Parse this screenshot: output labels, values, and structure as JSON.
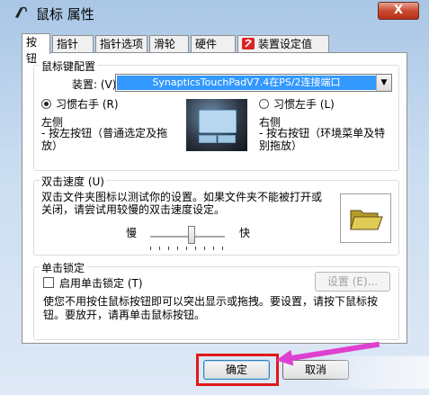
{
  "window": {
    "title": "鼠标 属性",
    "close_label": "X"
  },
  "tabs": [
    {
      "label": "按钮",
      "active": true
    },
    {
      "label": "指针"
    },
    {
      "label": "指针选项"
    },
    {
      "label": "滑轮"
    },
    {
      "label": "硬件"
    },
    {
      "label": "装置设定值"
    }
  ],
  "mouse_config": {
    "group_title": "鼠标键配置",
    "device_label": "装置: (V)",
    "device_value": "SynapticsTouchPadV7.4在PS/2连接端口",
    "right_hand_label": "习惯右手 (R)",
    "left_hand_label": "习惯左手 (L)",
    "selected": "right",
    "left_side_title": "左侧",
    "left_side_desc": "- 按左按钮（普通选定及拖放）",
    "right_side_title": "右侧",
    "right_side_desc": "- 按右按钮（环境菜单及特别拖放）"
  },
  "double_click": {
    "group_title": "双击速度 (U)",
    "instructions": "双击文件夹图标以测试你的设置。如果文件夹不能被打开或关闭，请尝试用较慢的双击速度设定。",
    "slow_label": "慢",
    "fast_label": "快",
    "speed_fraction": 0.55
  },
  "click_lock": {
    "group_title": "单击锁定",
    "checkbox_label": "启用单击锁定 (T)",
    "checked": false,
    "settings_button": "设置 (E)...",
    "description": "使您不用按住鼠标按钮即可以突出显示或拖拽。要设置，请按下鼠标按钮。要放开，请再单击鼠标按钮。"
  },
  "footer": {
    "ok_label": "确定",
    "cancel_label": "取消"
  },
  "colors": {
    "selection": "#3399ff",
    "highlight_box": "#e01a1a",
    "arrow": "#e040d0"
  }
}
